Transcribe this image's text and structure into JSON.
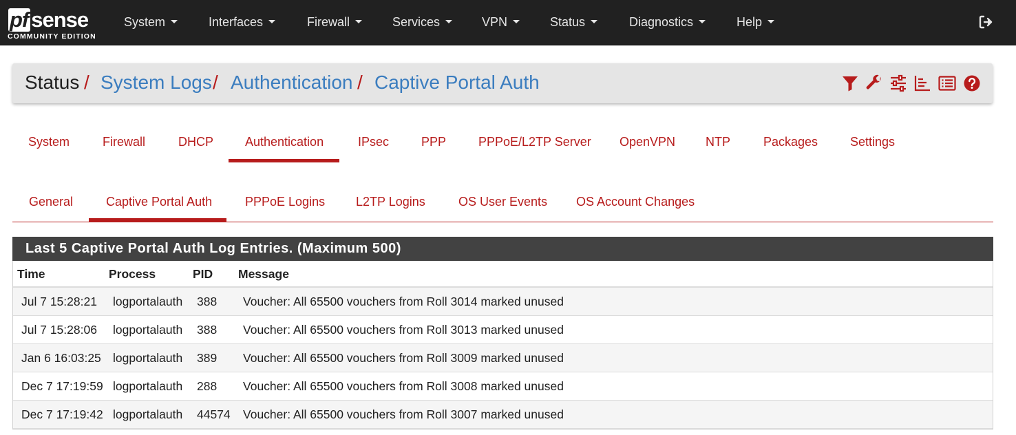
{
  "brand": {
    "logo_pf": "pf",
    "logo_rest": "sense",
    "edition": "COMMUNITY EDITION"
  },
  "nav": {
    "items": [
      "System",
      "Interfaces",
      "Firewall",
      "Services",
      "VPN",
      "Status",
      "Diagnostics",
      "Help"
    ],
    "logout_icon": "sign-out-icon"
  },
  "breadcrumb": {
    "root": "Status",
    "parts": [
      "System Logs",
      "Authentication",
      "Captive Portal Auth"
    ],
    "separator": "/"
  },
  "toolbar_icons": [
    "filter-icon",
    "wrench-icon",
    "sliders-icon",
    "chart-icon",
    "list-icon",
    "help-icon"
  ],
  "colors": {
    "accent": "#b71c1c",
    "link": "#3b7dbf",
    "nav_bg": "#212121",
    "panel_heading": "#424242"
  },
  "tabs": {
    "items": [
      "System",
      "Firewall",
      "DHCP",
      "Authentication",
      "IPsec",
      "PPP",
      "PPPoE/L2TP Server",
      "OpenVPN",
      "NTP",
      "Packages",
      "Settings"
    ],
    "active": "Authentication"
  },
  "subtabs": {
    "items": [
      "General",
      "Captive Portal Auth",
      "PPPoE Logins",
      "L2TP Logins",
      "OS User Events",
      "OS Account Changes"
    ],
    "active": "Captive Portal Auth"
  },
  "log_panel": {
    "title": "Last 5 Captive Portal Auth Log Entries. (Maximum 500)",
    "columns": [
      "Time",
      "Process",
      "PID",
      "Message"
    ],
    "rows": [
      [
        "Jul 7 15:28:21",
        "logportalauth",
        "388",
        "Voucher: All 65500 vouchers from Roll 3014 marked unused"
      ],
      [
        "Jul 7 15:28:06",
        "logportalauth",
        "388",
        "Voucher: All 65500 vouchers from Roll 3013 marked unused"
      ],
      [
        "Jan 6 16:03:25",
        "logportalauth",
        "389",
        "Voucher: All 65500 vouchers from Roll 3009 marked unused"
      ],
      [
        "Dec 7 17:19:59",
        "logportalauth",
        "288",
        "Voucher: All 65500 vouchers from Roll 3008 marked unused"
      ],
      [
        "Dec 7 17:19:42",
        "logportalauth",
        "44574",
        "Voucher: All 65500 vouchers from Roll 3007 marked unused"
      ]
    ]
  }
}
